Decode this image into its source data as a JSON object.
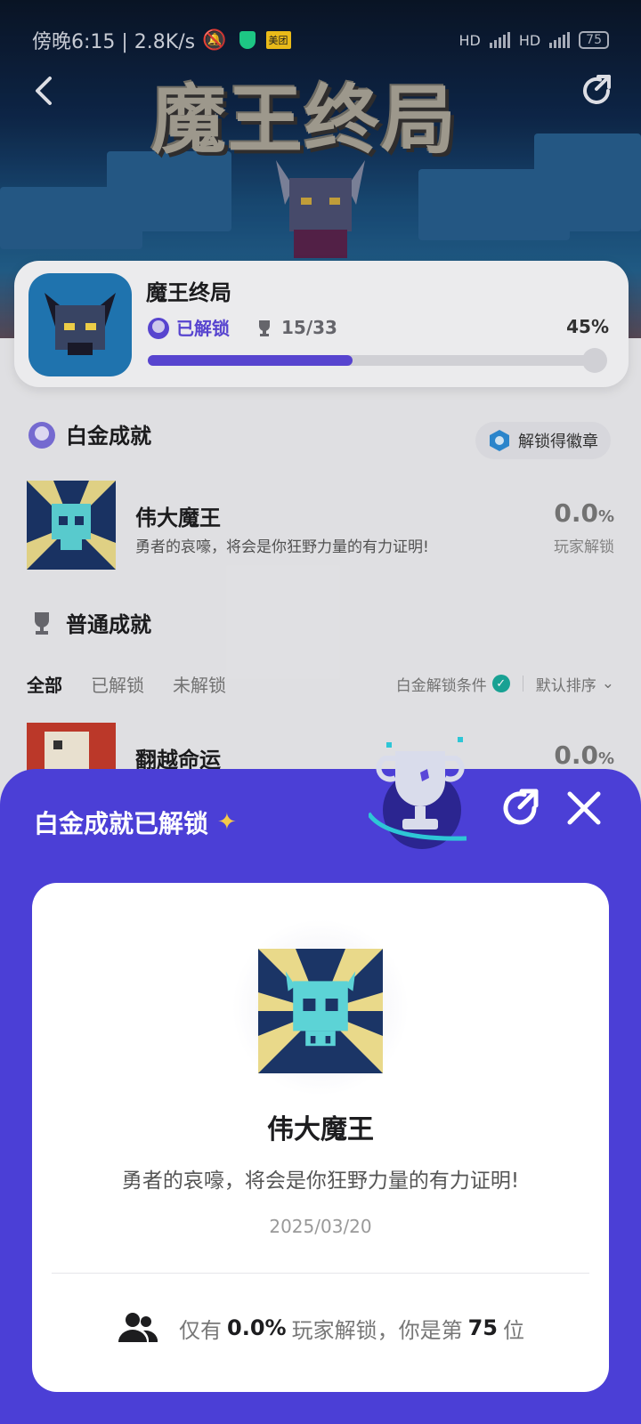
{
  "status_bar": {
    "time": "傍晚6:15 | 2.8K/s",
    "battery": "75"
  },
  "hero": {
    "title": "魔王终局"
  },
  "game": {
    "name": "魔王终局",
    "unlocked_label": "已解锁",
    "count": "15/33",
    "percent": "45%",
    "progress": 0.45
  },
  "platinum": {
    "section_title": "白金成就",
    "badge_button": "解锁得徽章",
    "item": {
      "title": "伟大魔王",
      "description": "勇者的哀嚎，将会是你狂野力量的有力证明!",
      "percent": "0.0",
      "percent_unit": "%",
      "sub": "玩家解锁"
    }
  },
  "normal": {
    "section_title": "普通成就",
    "tabs": [
      "全部",
      "已解锁",
      "未解锁"
    ],
    "condition_label": "白金解锁条件",
    "sort_label": "默认排序",
    "item": {
      "title": "翻越命运",
      "percent": "0.0",
      "percent_unit": "%"
    }
  },
  "sheet": {
    "title": "白金成就已解锁",
    "card": {
      "name": "伟大魔王",
      "description": "勇者的哀嚎，将会是你狂野力量的有力证明!",
      "date": "2025/03/20",
      "stat_prefix": "仅有",
      "stat_percent": "0.0%",
      "stat_middle": "玩家解锁，你是第",
      "stat_rank": "75",
      "stat_suffix": "位"
    }
  },
  "colors": {
    "accent": "#4b3fd6",
    "progress": "#5b47d8",
    "check": "#1aa89a"
  }
}
